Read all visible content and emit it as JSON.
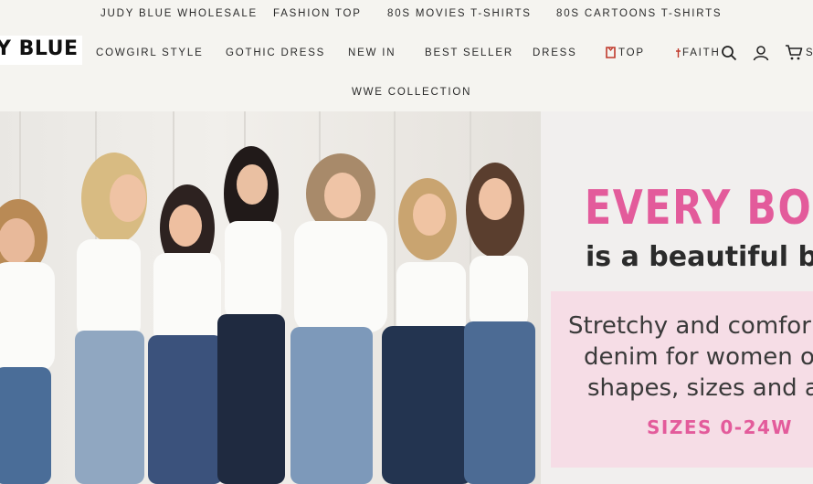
{
  "nav": {
    "top_row": [
      "JUDY BLUE WHOLESALE",
      "FASHION TOP",
      "80S MOVIES T-SHIRTS",
      "80S CARTOONS T-SHIRTS"
    ],
    "middle_row": [
      "COWGIRL STYLE",
      "GOTHIC DRESS",
      "NEW IN",
      "BEST SELLER",
      "DRESS",
      "TOP",
      "FAITH"
    ],
    "bottom_row": [
      "WWE COLLECTION"
    ]
  },
  "logo": {
    "text": "Y BLUE"
  },
  "icons": {
    "top_menu_icon": "shirt-icon",
    "faith_menu_icon": "cross-icon",
    "search": "search-icon",
    "account": "account-icon",
    "cart": "cart-icon",
    "cart_partial_text": "S"
  },
  "hero": {
    "headline": "EVERY BO",
    "subheadline": "is a beautiful bo",
    "description_lines": [
      "Stretchy and comfor",
      "denim for women o",
      "shapes, sizes and a"
    ],
    "sizes": "SIZES 0-24W"
  },
  "colors": {
    "accent_pink": "#e35b9b",
    "pink_box": "#f6dde6",
    "page_bg": "#f5f4f0"
  }
}
